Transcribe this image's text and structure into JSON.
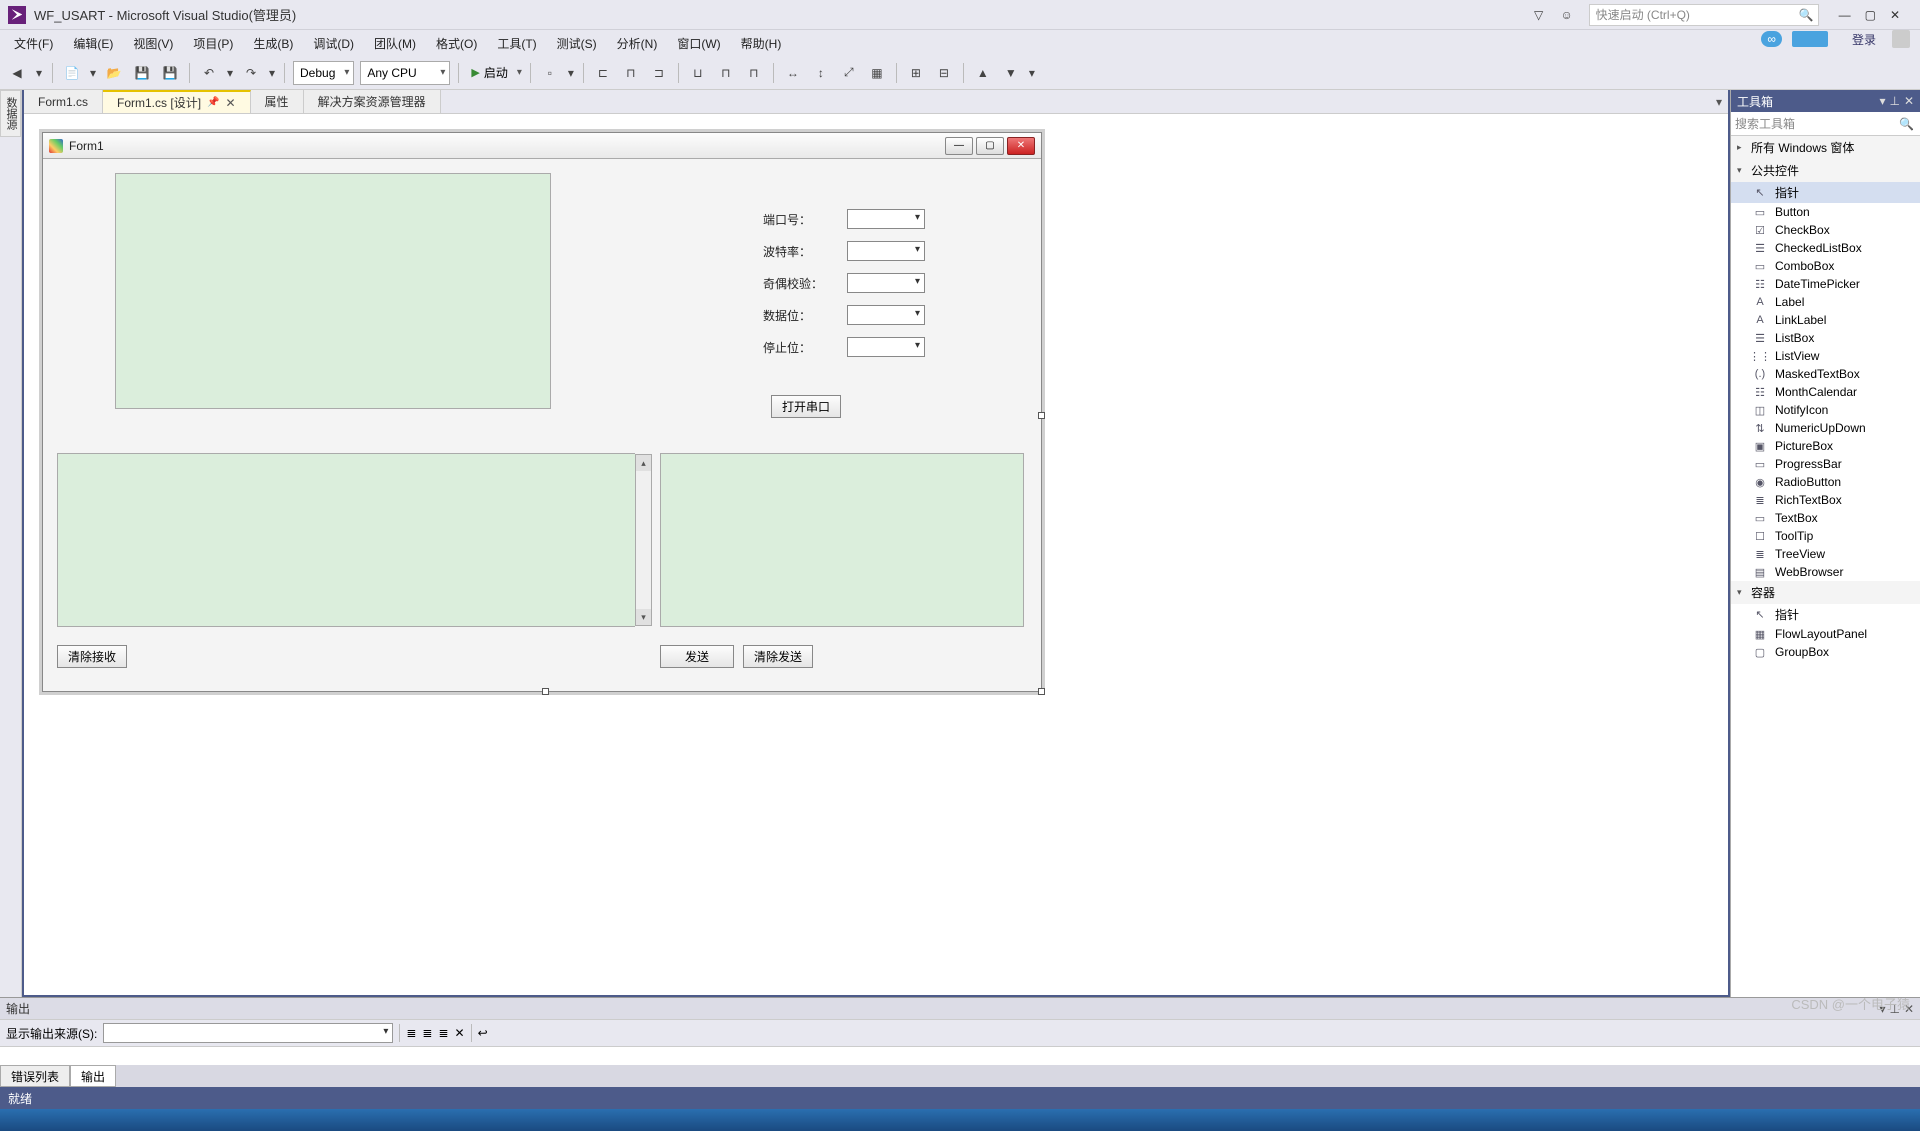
{
  "window": {
    "title": "WF_USART - Microsoft Visual Studio(管理员)",
    "quickLaunchPlaceholder": "快速启动 (Ctrl+Q)",
    "loginText": "登录"
  },
  "menus": [
    "文件(F)",
    "编辑(E)",
    "视图(V)",
    "项目(P)",
    "生成(B)",
    "调试(D)",
    "团队(M)",
    "格式(O)",
    "工具(T)",
    "测试(S)",
    "分析(N)",
    "窗口(W)",
    "帮助(H)"
  ],
  "toolbar": {
    "config": "Debug",
    "platform": "Any CPU",
    "startLabel": "启动"
  },
  "docTabs": [
    {
      "label": "Form1.cs",
      "active": false
    },
    {
      "label": "Form1.cs [设计]",
      "active": true,
      "pinned": true
    },
    {
      "label": "属性",
      "active": false
    },
    {
      "label": "解决方案资源管理器",
      "active": false
    }
  ],
  "leftVTab": "数据源",
  "designer": {
    "formTitle": "Form1",
    "fields": [
      {
        "label": "端口号："
      },
      {
        "label": "波特率："
      },
      {
        "label": "奇偶校验："
      },
      {
        "label": "数据位："
      },
      {
        "label": "停止位："
      }
    ],
    "openPortBtn": "打开串口",
    "clearRecvBtn": "清除接收",
    "sendBtn": "发送",
    "clearSendBtn": "清除发送"
  },
  "outputPanel": {
    "title": "输出",
    "sourceLabel": "显示输出来源(S):"
  },
  "bottomTabs": [
    {
      "label": "错误列表",
      "active": false
    },
    {
      "label": "输出",
      "active": true
    }
  ],
  "toolbox": {
    "title": "工具箱",
    "searchPlaceholder": "搜索工具箱",
    "groups": [
      {
        "name": "所有 Windows 窗体",
        "expanded": false
      },
      {
        "name": "公共控件",
        "expanded": true,
        "items": [
          {
            "label": "指针",
            "icon": "↖",
            "sel": true
          },
          {
            "label": "Button",
            "icon": "▭"
          },
          {
            "label": "CheckBox",
            "icon": "☑"
          },
          {
            "label": "CheckedListBox",
            "icon": "☰"
          },
          {
            "label": "ComboBox",
            "icon": "▭"
          },
          {
            "label": "DateTimePicker",
            "icon": "☷"
          },
          {
            "label": "Label",
            "icon": "A"
          },
          {
            "label": "LinkLabel",
            "icon": "A"
          },
          {
            "label": "ListBox",
            "icon": "☰"
          },
          {
            "label": "ListView",
            "icon": "⋮⋮"
          },
          {
            "label": "MaskedTextBox",
            "icon": "(.)"
          },
          {
            "label": "MonthCalendar",
            "icon": "☷"
          },
          {
            "label": "NotifyIcon",
            "icon": "◫"
          },
          {
            "label": "NumericUpDown",
            "icon": "⇅"
          },
          {
            "label": "PictureBox",
            "icon": "▣"
          },
          {
            "label": "ProgressBar",
            "icon": "▭"
          },
          {
            "label": "RadioButton",
            "icon": "◉"
          },
          {
            "label": "RichTextBox",
            "icon": "≣"
          },
          {
            "label": "TextBox",
            "icon": "▭"
          },
          {
            "label": "ToolTip",
            "icon": "☐"
          },
          {
            "label": "TreeView",
            "icon": "≣"
          },
          {
            "label": "WebBrowser",
            "icon": "▤"
          }
        ]
      },
      {
        "name": "容器",
        "expanded": true,
        "items": [
          {
            "label": "指针",
            "icon": "↖"
          },
          {
            "label": "FlowLayoutPanel",
            "icon": "▦"
          },
          {
            "label": "GroupBox",
            "icon": "▢"
          }
        ]
      }
    ]
  },
  "statusbar": {
    "ready": "就绪"
  },
  "watermark": "CSDN @一个电子猿"
}
